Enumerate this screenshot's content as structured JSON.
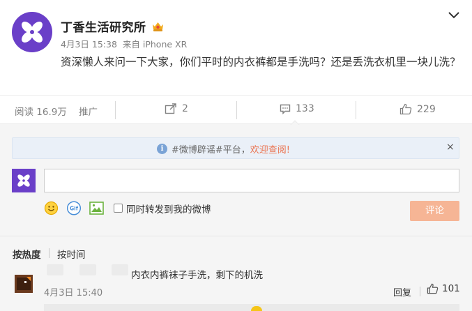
{
  "post": {
    "author": "丁香生活研究所",
    "date": "4月3日 15:38",
    "source": "来自 iPhone XR",
    "text": "资深懒人来问一下大家，你们平时的内衣裤都是手洗吗？还是丢洗衣机里一块儿洗？"
  },
  "actions": {
    "read_label": "阅读 16.9万",
    "promote_label": "推广",
    "repost_count": "2",
    "comment_count": "133",
    "like_count": "229"
  },
  "notice": {
    "prefix": "#微博辟谣#平台，",
    "link": "欢迎查阅!",
    "close": "×"
  },
  "composer": {
    "input_value": "",
    "sync_label": "同时转发到我的微博",
    "submit_label": "评论"
  },
  "sort": {
    "hot": "按热度",
    "time": "按时间"
  },
  "comment": {
    "text": "内衣内裤袜子手洗，剩下的机洗",
    "time": "4月3日 15:40",
    "reply_label": "回复",
    "like_count": "101"
  },
  "colors": {
    "brand_purple": "#6a3fc8",
    "link_orange": "#eb7350",
    "submit_disabled": "#f6b595",
    "notice_bg": "#eaf0f8"
  }
}
